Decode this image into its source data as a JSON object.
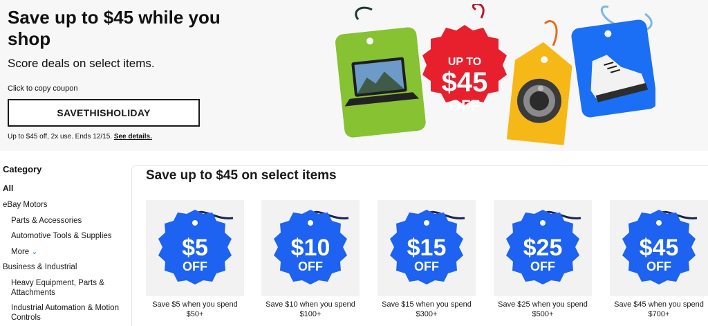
{
  "hero": {
    "title": "Save up to $45 while you shop",
    "subtitle": "Score deals on select items.",
    "coupon_hint": "Click to copy coupon",
    "coupon_code": "SAVETHISHOLIDAY",
    "terms": "Up to $45 off, 2x use. Ends 12/15.",
    "terms_link": "See details.",
    "badge_line1": "UP TO",
    "badge_amount": "$45",
    "badge_off": "OFF"
  },
  "sidebar": {
    "heading": "Category",
    "items": [
      {
        "label": "All",
        "level": 0
      },
      {
        "label": "eBay Motors",
        "level": 0
      },
      {
        "label": "Parts & Accessories",
        "level": 1
      },
      {
        "label": "Automotive Tools & Supplies",
        "level": 1
      },
      {
        "label": "More",
        "level": 1
      },
      {
        "label": "Business & Industrial",
        "level": 0
      },
      {
        "label": "Heavy Equipment, Parts & Attachments",
        "level": 1
      },
      {
        "label": "Industrial Automation & Motion Controls",
        "level": 1
      }
    ]
  },
  "main": {
    "title": "Save up to $45 on select items",
    "cards": [
      {
        "amount": "$5",
        "off": "OFF",
        "label": "Save $5 when you spend $50+"
      },
      {
        "amount": "$10",
        "off": "OFF",
        "label": "Save $10 when you spend $100+"
      },
      {
        "amount": "$15",
        "off": "OFF",
        "label": "Save $15 when you spend $300+"
      },
      {
        "amount": "$25",
        "off": "OFF",
        "label": "Save $25 when you spend $500+"
      },
      {
        "amount": "$45",
        "off": "OFF",
        "label": "Save $45 when you spend $700+"
      }
    ]
  },
  "colors": {
    "badge_blue": "#1d62f0",
    "badge_red": "#e8202e",
    "tag_green": "#86c232",
    "tag_yellow": "#f6b817",
    "tag_blue": "#1a6ff5",
    "string_navy": "#1a2453"
  }
}
